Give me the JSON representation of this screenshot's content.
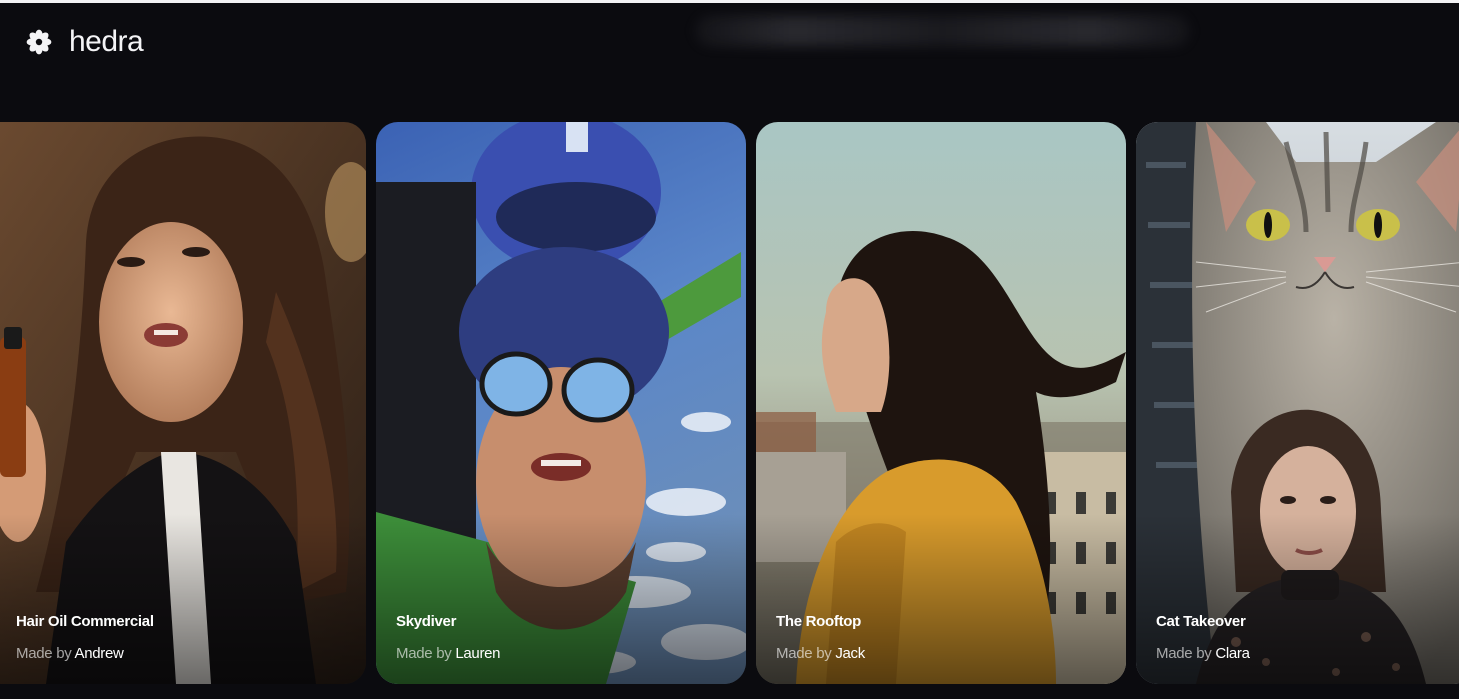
{
  "brand": {
    "name": "hedra",
    "logo_icon": "hedra-flower-icon"
  },
  "gallery": {
    "byline_prefix": "Made by",
    "items": [
      {
        "title": "Hair Oil Commercial",
        "author": "Andrew"
      },
      {
        "title": "Skydiver",
        "author": "Lauren"
      },
      {
        "title": "The Rooftop",
        "author": "Jack"
      },
      {
        "title": "Cat Takeover",
        "author": "Clara"
      }
    ]
  },
  "colors": {
    "background": "#0b0b0f",
    "text": "#ffffff",
    "muted_text": "#a0a0a6"
  }
}
